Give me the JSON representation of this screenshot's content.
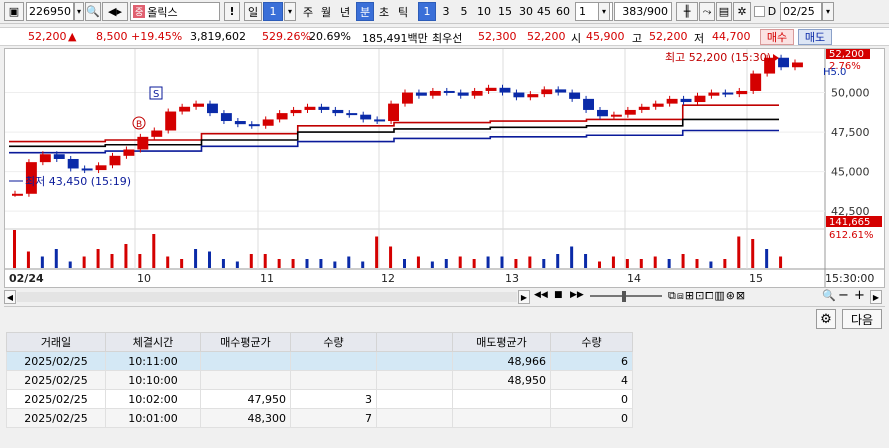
{
  "toolbar": {
    "code": "226950",
    "name": "올릭스",
    "name_badge": "중",
    "warn": "!",
    "period_day": "일",
    "period_num": "1",
    "periods": [
      "주",
      "월",
      "년",
      "분",
      "초",
      "틱"
    ],
    "selected_period": "분",
    "intervals": [
      "1",
      "3",
      "5",
      "10",
      "15",
      "30",
      "45",
      "60"
    ],
    "selected_interval": "1",
    "count_value": "1",
    "view_count": "383",
    "view_total": "/900",
    "date": "02/25",
    "d_label": "D"
  },
  "info": {
    "price": "52,200",
    "arrow": "▲",
    "change": "8,500",
    "change_pct": "+19.45%",
    "volume": "3,819,602",
    "vol_ratio": "529.26%",
    "turnover": "20.69%",
    "amount": "185,491백만",
    "best_label": "최우선",
    "best_ask": "52,300",
    "best_bid": "52,200",
    "open_label": "시",
    "open": "45,900",
    "high_label": "고",
    "high": "52,200",
    "low_label": "저",
    "low": "44,700",
    "buy_btn": "매수",
    "sell_btn": "매도"
  },
  "chart_data": {
    "type": "candlestick",
    "x_labels": [
      "02/24",
      "10",
      "11",
      "12",
      "13",
      "14",
      "15",
      "15:30:00"
    ],
    "y_ticks": [
      42500,
      45000,
      47500,
      50000
    ],
    "ylim": [
      41500,
      52500
    ],
    "price_tag": "52,200",
    "pct_tag": "2.76%",
    "hs_tag": "H5.0",
    "high_annotation": "최고 52,200 (15:30)",
    "low_annotation": "최저 43,450 (15:19)",
    "signal_s": "S",
    "signal_b": "B",
    "volume_tag": "141,665",
    "volume_pct_tag": "612.61%",
    "trend_lines": [
      {
        "color": "#c00000",
        "values": [
          46900,
          47000,
          47400,
          47900,
          48100,
          48200,
          48300,
          49200
        ]
      },
      {
        "color": "#000000",
        "values": [
          46600,
          46700,
          47000,
          47500,
          47700,
          47800,
          47900,
          48300
        ]
      },
      {
        "color": "#0a1a9a",
        "values": [
          46200,
          46300,
          46600,
          46900,
          47100,
          47200,
          47300,
          47600
        ]
      }
    ],
    "price_series": [
      43600,
      45600,
      46100,
      45800,
      45200,
      45100,
      45400,
      46000,
      46400,
      47200,
      47600,
      48800,
      49100,
      49300,
      48700,
      48200,
      48000,
      47900,
      48300,
      48700,
      48900,
      49100,
      48900,
      48700,
      48600,
      48300,
      48200,
      49300,
      50000,
      49800,
      50100,
      50000,
      49800,
      50100,
      50300,
      50000,
      49700,
      49900,
      50200,
      50000,
      49600,
      48900,
      48500,
      48600,
      48900,
      49100,
      49300,
      49600,
      49400,
      49800,
      50000,
      49900,
      50100,
      51200,
      52200,
      51600,
      51900
    ]
  },
  "table": {
    "settings_icon": "gear-icon",
    "next_label": "다음",
    "headers": [
      "거래일",
      "체결시간",
      "매수평균가",
      "수량",
      "",
      "매도평균가",
      "수량"
    ],
    "rows": [
      [
        "2025/02/25",
        "10:11:00",
        "",
        "",
        "",
        "48,966",
        "6"
      ],
      [
        "2025/02/25",
        "10:10:00",
        "",
        "",
        "",
        "48,950",
        "4"
      ],
      [
        "2025/02/25",
        "10:02:00",
        "47,950",
        "3",
        "",
        "",
        "0"
      ],
      [
        "2025/02/25",
        "10:01:00",
        "48,300",
        "7",
        "",
        "",
        "0"
      ]
    ]
  }
}
